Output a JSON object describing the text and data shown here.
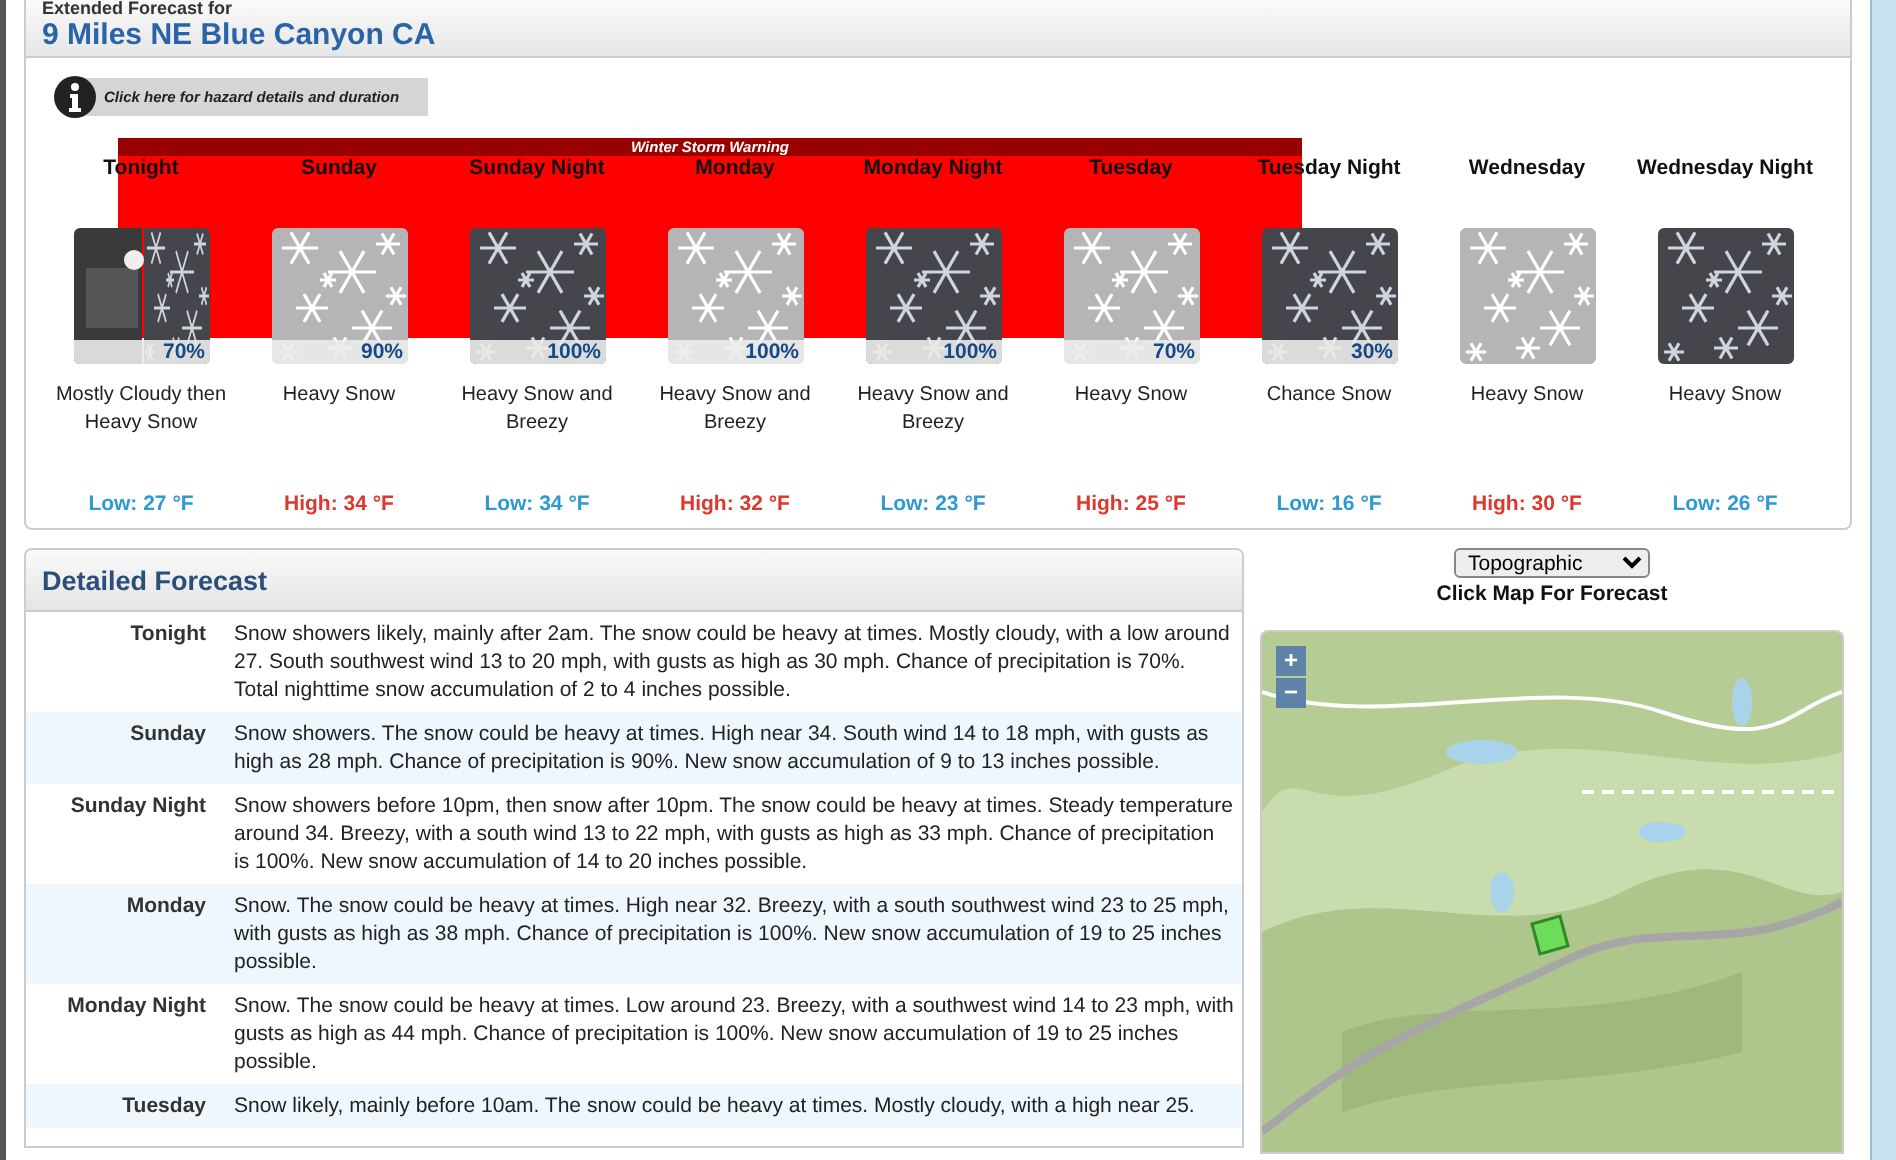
{
  "header": {
    "subtitle": "Extended Forecast for",
    "title": "9 Miles NE Blue Canyon CA"
  },
  "hazard": {
    "label": "Click here for hazard details and duration",
    "warning": "Winter Storm Warning"
  },
  "periods": [
    {
      "name": "Tonight",
      "kind": "split",
      "pop": "70%",
      "short": "Mostly Cloudy then Heavy Snow",
      "temp": "Low: 27 °F",
      "high": false,
      "warning": true
    },
    {
      "name": "Sunday",
      "kind": "day",
      "pop": "90%",
      "short": "Heavy Snow",
      "temp": "High: 34 °F",
      "high": true,
      "warning": true
    },
    {
      "name": "Sunday Night",
      "kind": "night",
      "pop": "100%",
      "short": "Heavy Snow and Breezy",
      "temp": "Low: 34 °F",
      "high": false,
      "warning": true
    },
    {
      "name": "Monday",
      "kind": "day",
      "pop": "100%",
      "short": "Heavy Snow and Breezy",
      "temp": "High: 32 °F",
      "high": true,
      "warning": true
    },
    {
      "name": "Monday Night",
      "kind": "night",
      "pop": "100%",
      "short": "Heavy Snow and Breezy",
      "temp": "Low: 23 °F",
      "high": false,
      "warning": true
    },
    {
      "name": "Tuesday",
      "kind": "day",
      "pop": "70%",
      "short": "Heavy Snow",
      "temp": "High: 25 °F",
      "high": true,
      "warning": true
    },
    {
      "name": "Tuesday Night",
      "kind": "night",
      "pop": "30%",
      "short": "Chance Snow",
      "temp": "Low: 16 °F",
      "high": false,
      "warning": false
    },
    {
      "name": "Wednesday",
      "kind": "day",
      "short": "Heavy Snow",
      "temp": "High: 30 °F",
      "high": true,
      "warning": false
    },
    {
      "name": "Wednesday Night",
      "kind": "night",
      "short": "Heavy Snow",
      "temp": "Low: 26 °F",
      "high": false,
      "warning": false
    }
  ],
  "detailed": {
    "title": "Detailed Forecast",
    "rows": [
      {
        "label": "Tonight",
        "text": "Snow showers likely, mainly after 2am. The snow could be heavy at times. Mostly cloudy, with a low around 27. South southwest wind 13 to 20 mph, with gusts as high as 30 mph. Chance of precipitation is 70%. Total nighttime snow accumulation of 2 to 4 inches possible."
      },
      {
        "label": "Sunday",
        "text": "Snow showers. The snow could be heavy at times. High near 34. South wind 14 to 18 mph, with gusts as high as 28 mph. Chance of precipitation is 90%. New snow accumulation of 9 to 13 inches possible."
      },
      {
        "label": "Sunday Night",
        "text": "Snow showers before 10pm, then snow after 10pm. The snow could be heavy at times. Steady temperature around 34. Breezy, with a south wind 13 to 22 mph, with gusts as high as 33 mph. Chance of precipitation is 100%. New snow accumulation of 14 to 20 inches possible."
      },
      {
        "label": "Monday",
        "text": "Snow. The snow could be heavy at times. High near 32. Breezy, with a south southwest wind 23 to 25 mph, with gusts as high as 38 mph. Chance of precipitation is 100%. New snow accumulation of 19 to 25 inches possible."
      },
      {
        "label": "Monday Night",
        "text": "Snow. The snow could be heavy at times. Low around 23. Breezy, with a southwest wind 14 to 23 mph, with gusts as high as 44 mph. Chance of precipitation is 100%. New snow accumulation of 19 to 25 inches possible."
      },
      {
        "label": "Tuesday",
        "text": "Snow likely, mainly before 10am. The snow could be heavy at times. Mostly cloudy, with a high near 25."
      }
    ]
  },
  "map": {
    "layer": "Topographic",
    "caption": "Click Map For Forecast",
    "zoom_in": "+",
    "zoom_out": "−"
  }
}
